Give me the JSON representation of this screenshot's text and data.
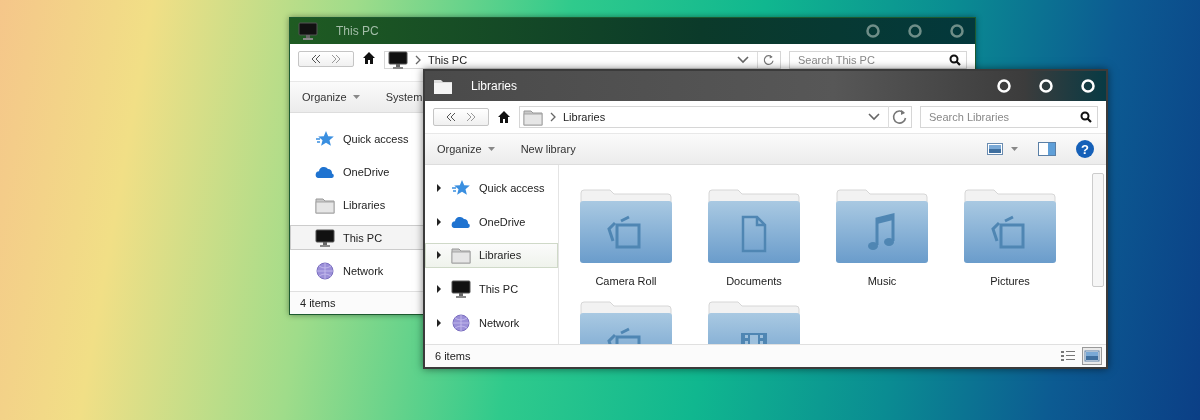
{
  "windows": [
    {
      "title": "This PC",
      "active": false,
      "address": {
        "kind": "pc",
        "label": "This PC"
      },
      "search": {
        "placeholder": "Search This PC"
      },
      "toolbar": [
        {
          "label": "Organize",
          "dropdown": true
        },
        {
          "label": "System",
          "dropdown": false
        }
      ],
      "nav": [
        {
          "label": "Quick access",
          "kind": "quick",
          "selected": false
        },
        {
          "label": "OneDrive",
          "kind": "cloud",
          "selected": false
        },
        {
          "label": "Libraries",
          "kind": "folder",
          "selected": false
        },
        {
          "label": "This PC",
          "kind": "pc",
          "selected": true
        },
        {
          "label": "Network",
          "kind": "network",
          "selected": false
        }
      ],
      "status": "4 items"
    },
    {
      "title": "Libraries",
      "active": true,
      "address": {
        "kind": "folder",
        "label": "Libraries"
      },
      "help": "?",
      "search": {
        "placeholder": "Search Libraries"
      },
      "toolbar": [
        {
          "label": "Organize",
          "dropdown": true
        },
        {
          "label": "New library",
          "dropdown": false
        }
      ],
      "nav": [
        {
          "label": "Quick access",
          "kind": "quick",
          "selected": false,
          "expanded": false
        },
        {
          "label": "OneDrive",
          "kind": "cloud",
          "selected": false,
          "expanded": false
        },
        {
          "label": "Libraries",
          "kind": "folder",
          "selected": true,
          "expanded": false
        },
        {
          "label": "This PC",
          "kind": "pc",
          "selected": false,
          "expanded": false
        },
        {
          "label": "Network",
          "kind": "network",
          "selected": false,
          "expanded": false
        }
      ],
      "items": [
        {
          "label": "Camera Roll",
          "kind": "photo"
        },
        {
          "label": "Documents",
          "kind": "doc"
        },
        {
          "label": "Music",
          "kind": "music"
        },
        {
          "label": "Pictures",
          "kind": "photo"
        },
        {
          "kind": "photo"
        },
        {
          "kind": "video"
        }
      ],
      "view_buttons": [
        {
          "kind": "details",
          "selected": false
        },
        {
          "kind": "icons",
          "selected": true
        }
      ],
      "status": "6 items"
    }
  ]
}
